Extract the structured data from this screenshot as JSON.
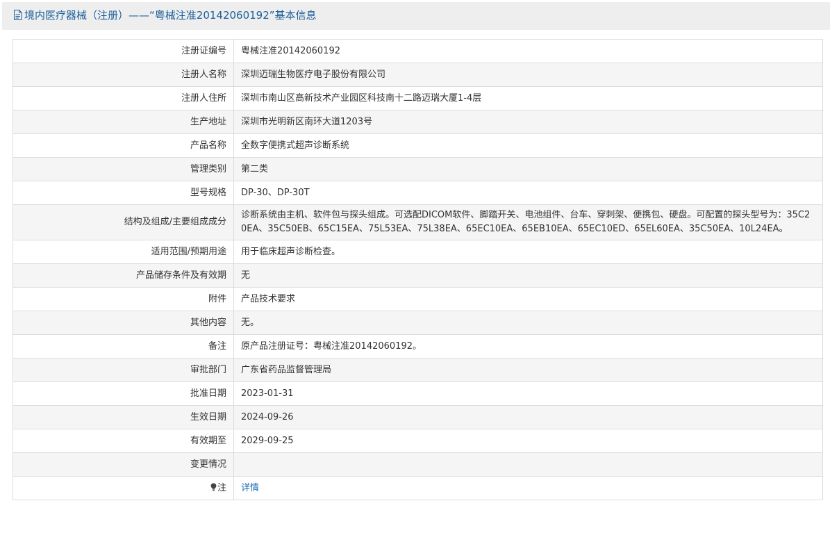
{
  "header": {
    "title": "境内医疗器械（注册）——“粤械注准20142060192”基本信息",
    "icon": "document-icon",
    "color": "#1a5e9a"
  },
  "rows": [
    {
      "label": "注册证编号",
      "value": "粤械注准20142060192"
    },
    {
      "label": "注册人名称",
      "value": "深圳迈瑞生物医疗电子股份有限公司"
    },
    {
      "label": "注册人住所",
      "value": "深圳市南山区高新技术产业园区科技南十二路迈瑞大厦1-4层"
    },
    {
      "label": "生产地址",
      "value": "深圳市光明新区南环大道1203号"
    },
    {
      "label": "产品名称",
      "value": "全数字便携式超声诊断系统"
    },
    {
      "label": "管理类别",
      "value": "第二类"
    },
    {
      "label": "型号规格",
      "value": "DP-30、DP-30T"
    },
    {
      "label": "结构及组成/主要组成成分",
      "value": "诊断系统由主机、软件包与探头组成。可选配DICOM软件、脚踏开关、电池组件、台车、穿刺架、便携包、硬盘。可配置的探头型号为：35C20EA、35C50EB、65C15EA、75L53EA、75L38EA、65EC10EA、65EB10EA、65EC10ED、65EL60EA、35C50EA、10L24EA。"
    },
    {
      "label": "适用范围/预期用途",
      "value": "用于临床超声诊断检查。"
    },
    {
      "label": "产品储存条件及有效期",
      "value": "无"
    },
    {
      "label": "附件",
      "value": "产品技术要求"
    },
    {
      "label": "其他内容",
      "value": "无。"
    },
    {
      "label": "备注",
      "value": "原产品注册证号：粤械注准20142060192。"
    },
    {
      "label": "审批部门",
      "value": "广东省药品监督管理局"
    },
    {
      "label": "批准日期",
      "value": "2023-01-31"
    },
    {
      "label": "生效日期",
      "value": "2024-09-26"
    },
    {
      "label": "有效期至",
      "value": "2029-09-25"
    },
    {
      "label": "变更情况",
      "value": ""
    }
  ],
  "note": {
    "icon": "lightbulb-icon",
    "label": "注",
    "link_text": "详情",
    "link_color": "#1a6ab0"
  }
}
